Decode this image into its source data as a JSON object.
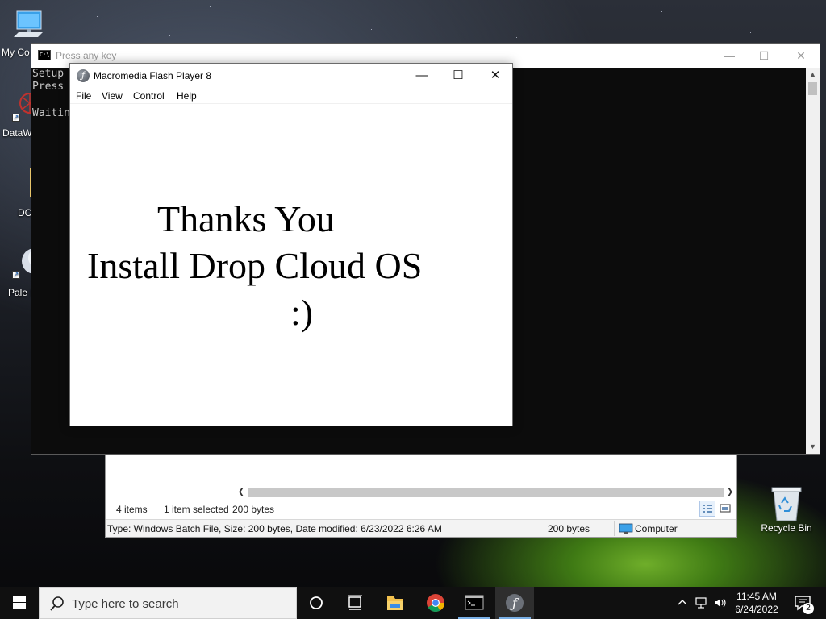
{
  "desktop": {
    "icons": [
      {
        "label": "My Co",
        "icon": "computer-icon"
      },
      {
        "label": "DataW",
        "icon": "datawrapper-icon"
      },
      {
        "label": "DC",
        "icon": "folder-icon"
      },
      {
        "label": "Pale M",
        "icon": "pale-moon-icon"
      }
    ],
    "recycle_bin_label": "Recycle Bin"
  },
  "explorer": {
    "item_count": "4 items",
    "selection": "1 item selected",
    "selection_size": "200 bytes",
    "details": "Type: Windows Batch File, Size: 200 bytes, Date modified: 6/23/2022 6:26 AM",
    "size_cell": "200 bytes",
    "location": "Computer"
  },
  "console": {
    "title": "Press any key",
    "lines": [
      "Setup",
      "Press",
      "",
      "Waitin"
    ]
  },
  "flash": {
    "title": "Macromedia Flash Player 8",
    "menu": [
      "File",
      "View",
      "Control",
      "Help"
    ],
    "message": [
      "Thanks You",
      "Install Drop Cloud OS",
      ":)"
    ]
  },
  "taskbar": {
    "search_placeholder": "Type here to search",
    "apps": [
      "cortana-icon",
      "task-view-icon",
      "file-explorer-icon",
      "chrome-icon",
      "command-prompt-icon",
      "flash-player-icon"
    ],
    "clock_time": "11:45 AM",
    "clock_date": "6/24/2022",
    "notification_count": "2"
  },
  "colors": {
    "taskbar": "#101010",
    "accent": "#7ab0e6",
    "console_bg": "#0c0c0c"
  }
}
